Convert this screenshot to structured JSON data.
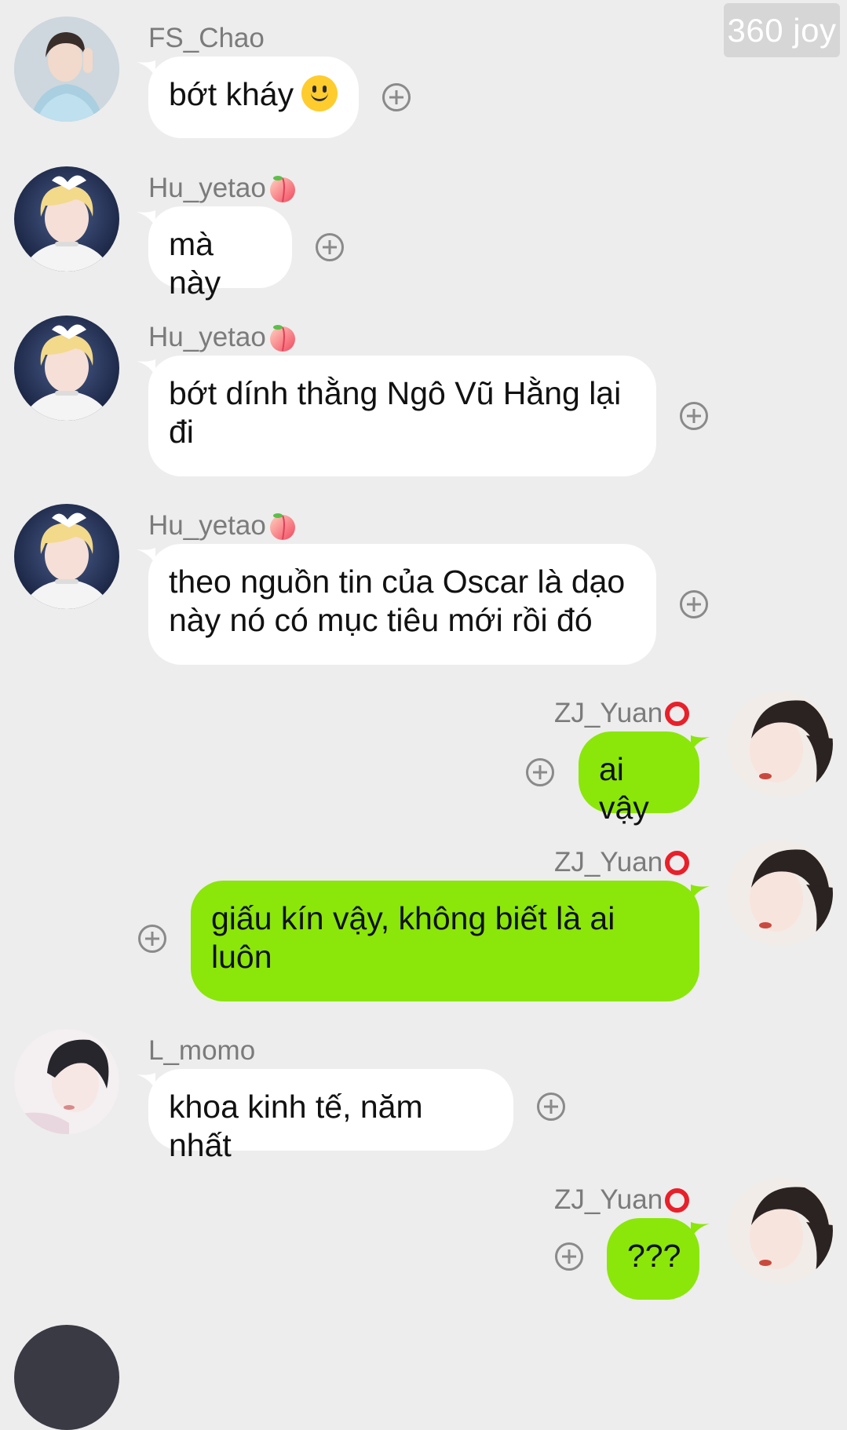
{
  "watermark": "360 joy",
  "messages": [
    {
      "sender": "FS_Chao",
      "badge": "",
      "text": "bớt kháy",
      "emoji": "slightly-smiling-face"
    },
    {
      "sender": "Hu_yetao",
      "badge": "peach",
      "text": "mà này"
    },
    {
      "sender": "Hu_yetao",
      "badge": "peach",
      "text": "bớt dính thằng Ngô Vũ Hằng lại đi"
    },
    {
      "sender": "Hu_yetao",
      "badge": "peach",
      "text": "theo nguồn tin của Oscar là dạo này nó có mục tiêu mới rồi đó"
    },
    {
      "sender": "ZJ_Yuan",
      "badge": "red-circle",
      "text": "ai vậy"
    },
    {
      "sender": "ZJ_Yuan",
      "badge": "red-circle",
      "text": "giấu kín vậy, không biết là ai luôn"
    },
    {
      "sender": "L_momo",
      "badge": "",
      "text": "khoa kinh tế, năm nhất"
    },
    {
      "sender": "ZJ_Yuan",
      "badge": "red-circle",
      "text": "???"
    }
  ],
  "colors": {
    "background": "#ededed",
    "incoming_bubble": "#ffffff",
    "outgoing_bubble": "#8be60a",
    "name_text": "#7b7b7b"
  },
  "icons": {
    "add_reaction": "plus-circle-icon"
  }
}
